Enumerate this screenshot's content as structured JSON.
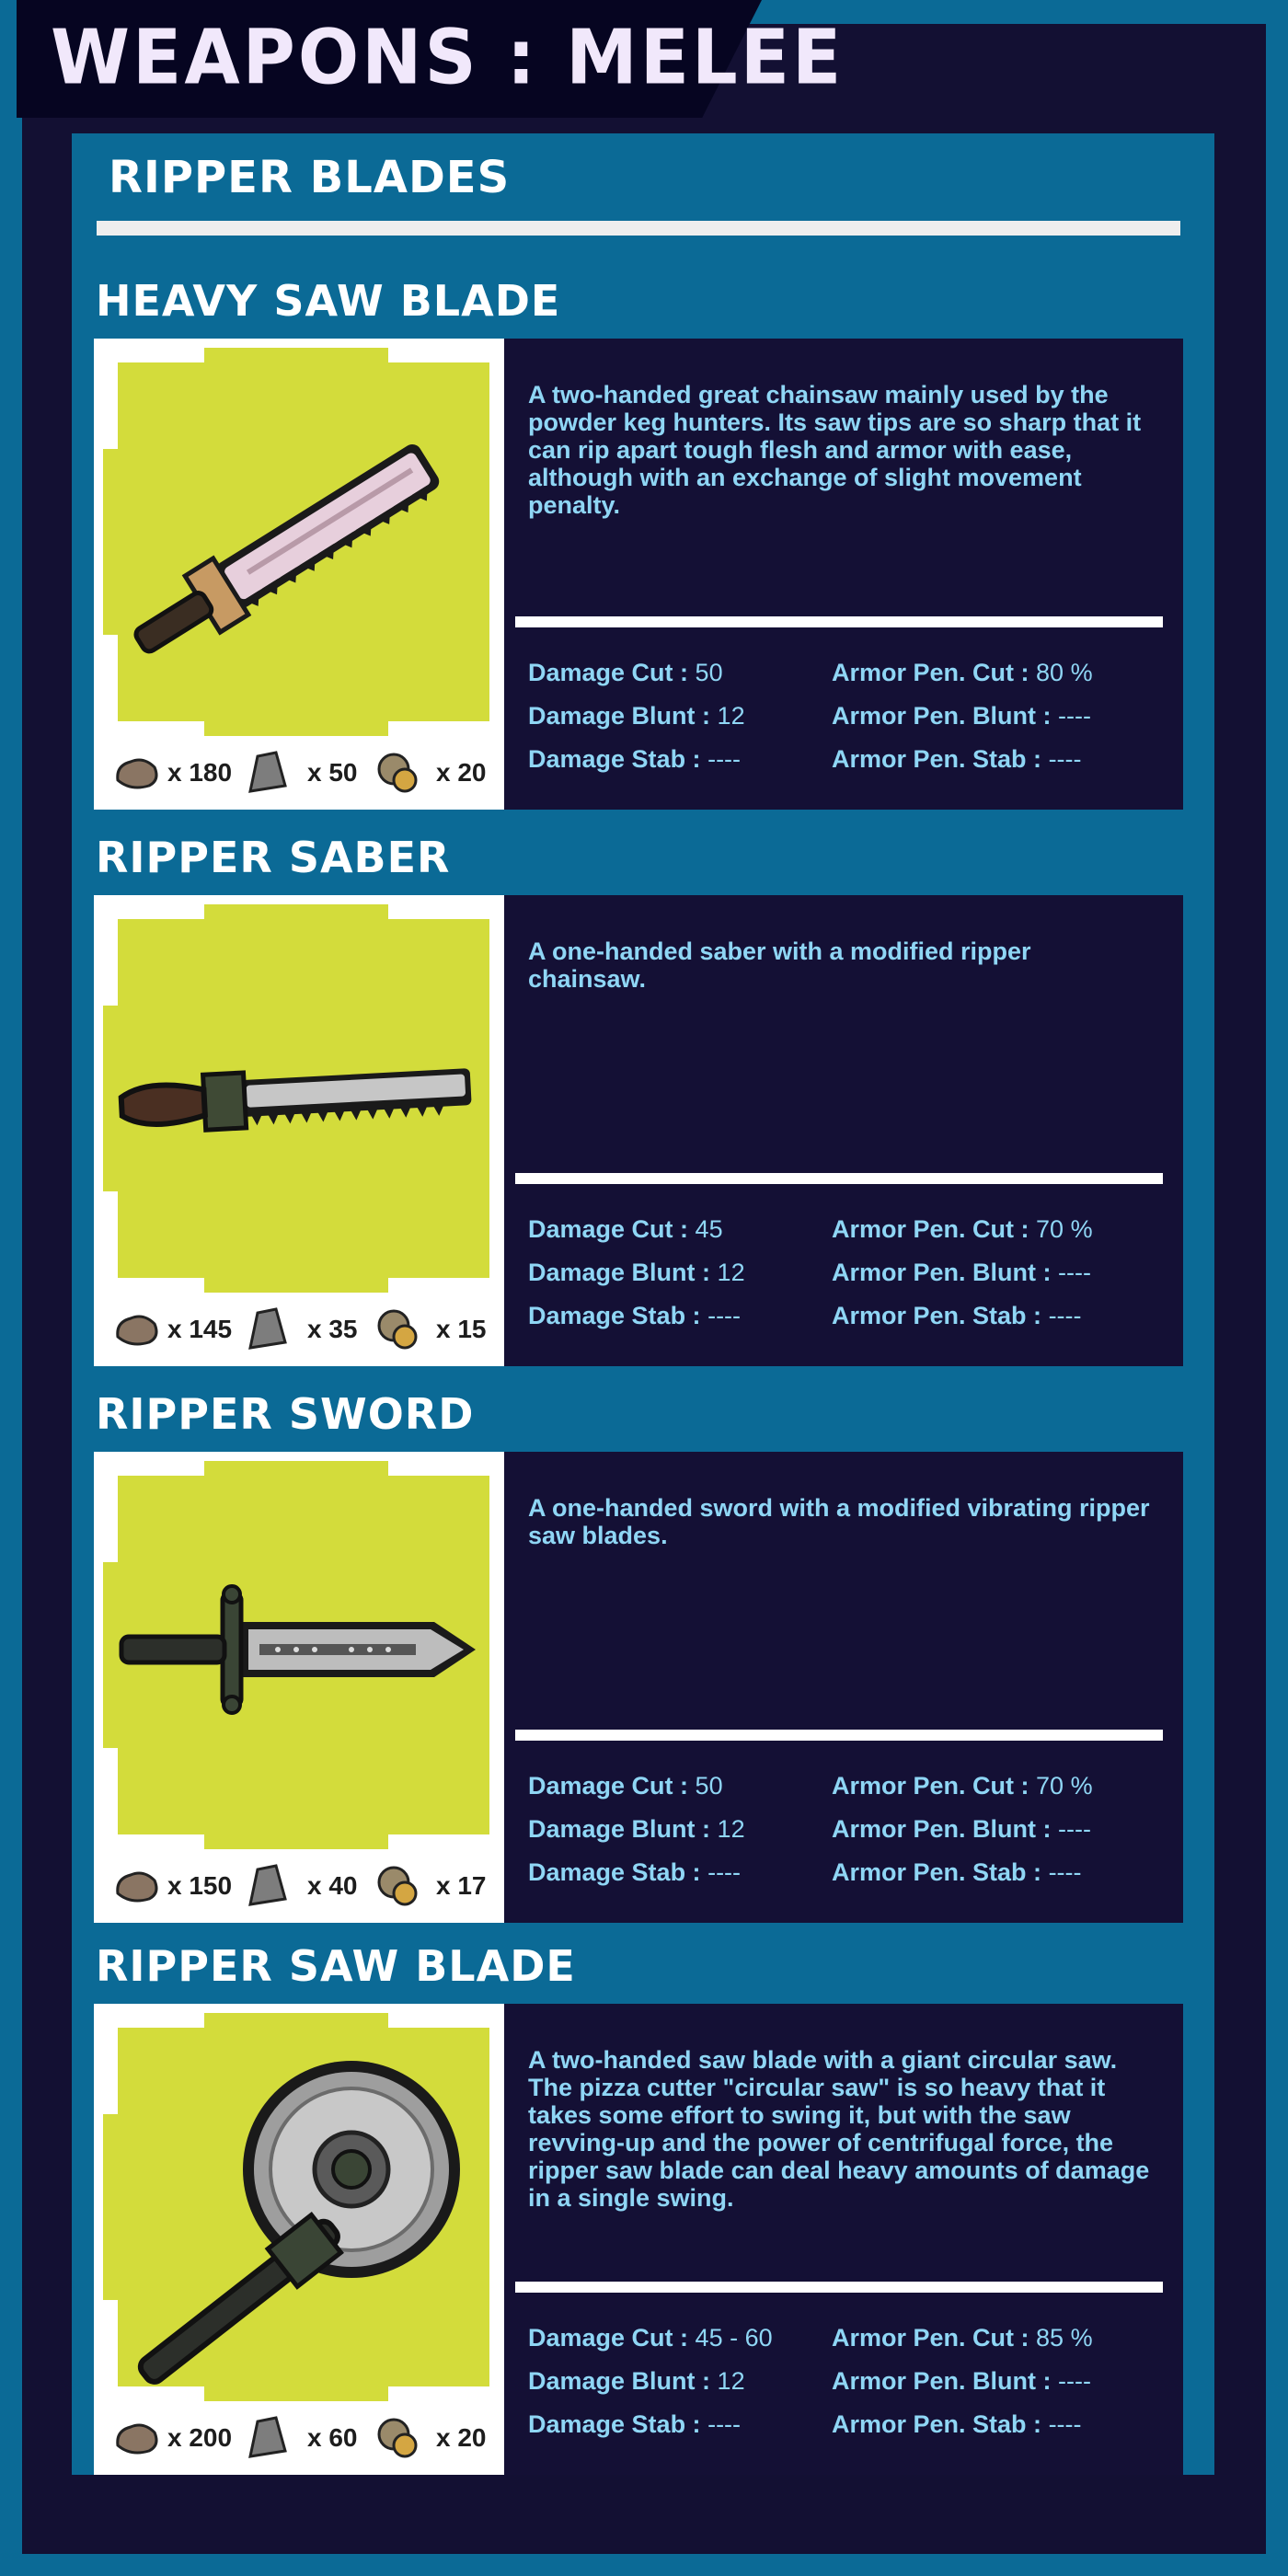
{
  "page_title": "WEAPONS : MELEE",
  "section_title": "RIPPER BLADES",
  "colors": {
    "background": "#0b6a96",
    "dark": "#131033",
    "card_image_bg": "#d3dc3b",
    "text_light": "#8fd6f5"
  },
  "stat_labels": {
    "damage_cut": "Damage Cut :",
    "damage_blunt": "Damage Blunt :",
    "damage_stab": "Damage Stab :",
    "armor_cut": "Armor Pen. Cut :",
    "armor_blunt": "Armor Pen. Blunt :",
    "armor_stab": "Armor Pen. Stab :"
  },
  "items": [
    {
      "name": "HEAVY SAW BLADE",
      "description": "A two-handed great chainsaw mainly used by the powder keg hunters. Its saw tips are so sharp that it can rip apart tough flesh and armor with ease, although with an exchange of slight movement penalty.",
      "damage_cut": "50",
      "damage_blunt": "12",
      "damage_stab": "----",
      "armor_cut": "80 %",
      "armor_blunt": "----",
      "armor_stab": "----",
      "cost": {
        "ore": "x 180",
        "stone": "x 50",
        "scrap": "x 20"
      }
    },
    {
      "name": "RIPPER SABER",
      "description": "A one-handed saber with a modified ripper chainsaw.",
      "damage_cut": "45",
      "damage_blunt": "12",
      "damage_stab": "----",
      "armor_cut": "70 %",
      "armor_blunt": "----",
      "armor_stab": "----",
      "cost": {
        "ore": "x 145",
        "stone": "x 35",
        "scrap": "x 15"
      }
    },
    {
      "name": "RIPPER SWORD",
      "description": "A one-handed sword with a modified vibrating ripper saw blades.",
      "damage_cut": "50",
      "damage_blunt": "12",
      "damage_stab": "----",
      "armor_cut": "70 %",
      "armor_blunt": "----",
      "armor_stab": "----",
      "cost": {
        "ore": "x 150",
        "stone": "x 40",
        "scrap": "x 17"
      }
    },
    {
      "name": "RIPPER SAW BLADE",
      "description": "A two-handed saw blade with a giant circular saw. The pizza cutter \"circular saw\" is so heavy that it takes some effort to swing it, but with the saw revving-up and the power of centrifugal force, the ripper saw blade can deal heavy amounts of damage in a single swing.",
      "damage_cut": "45 - 60",
      "damage_blunt": "12",
      "damage_stab": "----",
      "armor_cut": "85 %",
      "armor_blunt": "----",
      "armor_stab": "----",
      "cost": {
        "ore": "x 200",
        "stone": "x 60",
        "scrap": "x 20"
      }
    }
  ]
}
